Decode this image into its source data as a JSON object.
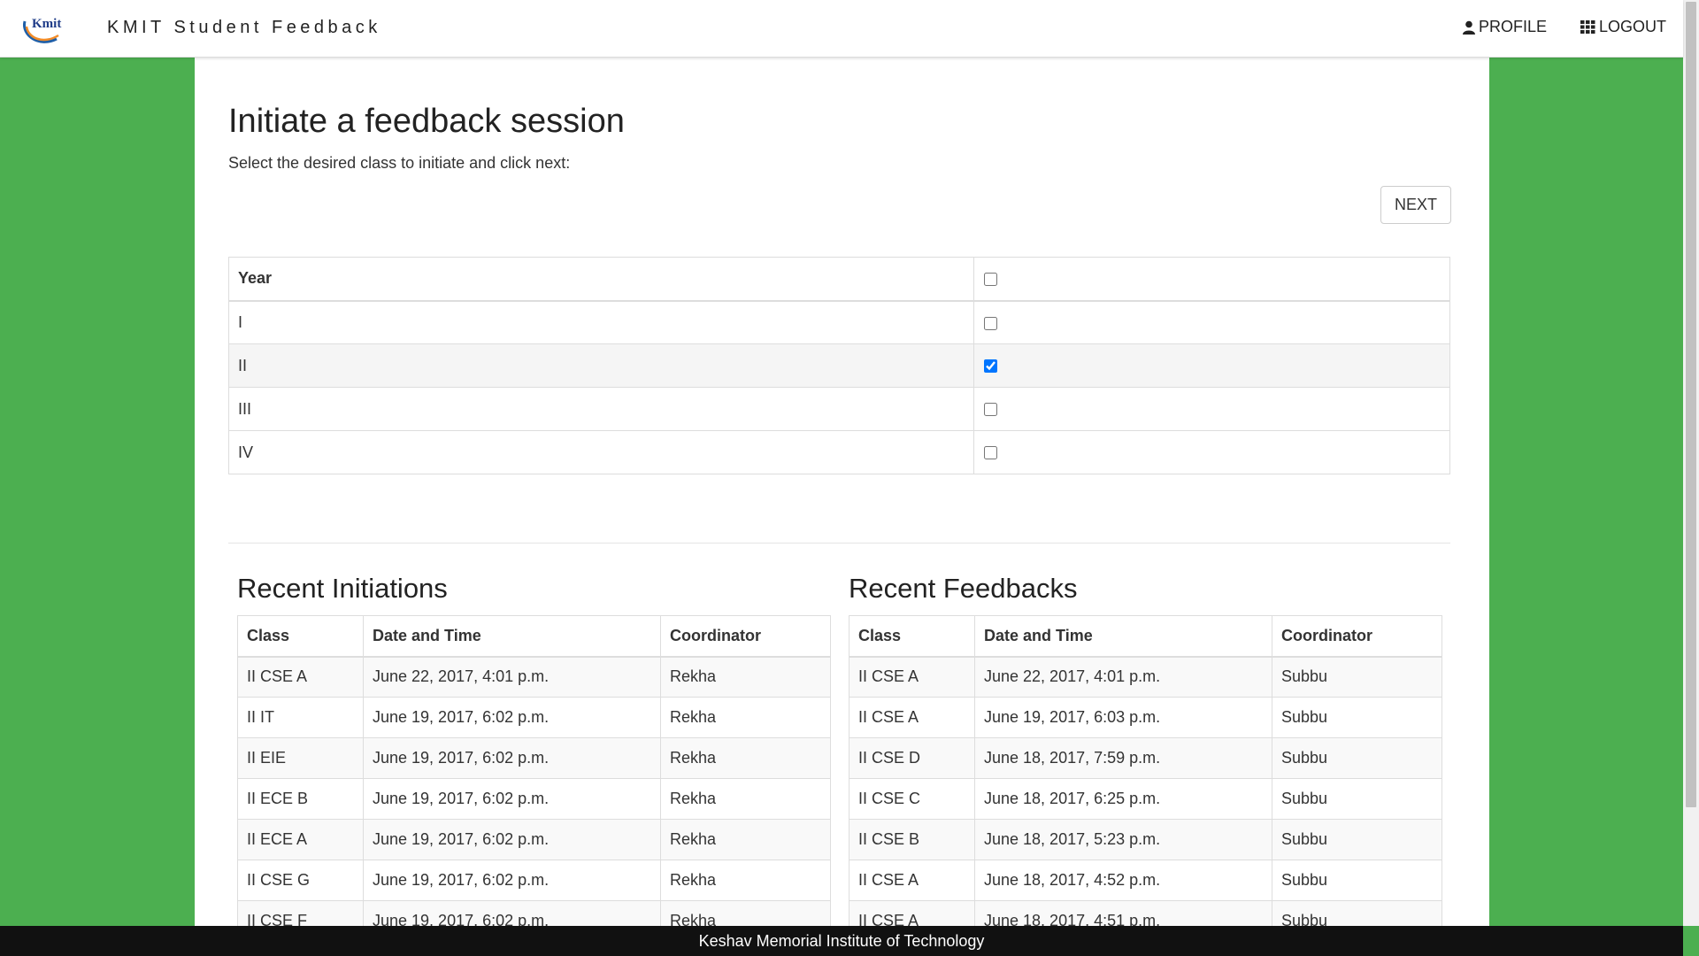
{
  "header": {
    "brand": "KMIT Student Feedback",
    "logo_text": "Kmit",
    "profile_label": "PROFILE",
    "logout_label": "LOGOUT"
  },
  "main": {
    "title": "Initiate a feedback session",
    "subtitle": "Select the desired class to initiate and click next:",
    "next_label": "NEXT",
    "year_table": {
      "header": "Year",
      "header_checked": false,
      "rows": [
        {
          "label": "I",
          "checked": false
        },
        {
          "label": "II",
          "checked": true
        },
        {
          "label": "III",
          "checked": false
        },
        {
          "label": "IV",
          "checked": false
        }
      ]
    }
  },
  "recent_initiations": {
    "title": "Recent Initiations",
    "columns": [
      "Class",
      "Date and Time",
      "Coordinator"
    ],
    "rows": [
      [
        "II CSE A",
        "June 22, 2017, 4:01 p.m.",
        "Rekha"
      ],
      [
        "II IT",
        "June 19, 2017, 6:02 p.m.",
        "Rekha"
      ],
      [
        "II EIE",
        "June 19, 2017, 6:02 p.m.",
        "Rekha"
      ],
      [
        "II ECE B",
        "June 19, 2017, 6:02 p.m.",
        "Rekha"
      ],
      [
        "II ECE A",
        "June 19, 2017, 6:02 p.m.",
        "Rekha"
      ],
      [
        "II CSE G",
        "June 19, 2017, 6:02 p.m.",
        "Rekha"
      ],
      [
        "II CSE F",
        "June 19, 2017, 6:02 p.m.",
        "Rekha"
      ]
    ]
  },
  "recent_feedbacks": {
    "title": "Recent Feedbacks",
    "columns": [
      "Class",
      "Date and Time",
      "Coordinator"
    ],
    "rows": [
      [
        "II CSE A",
        "June 22, 2017, 4:01 p.m.",
        "Subbu"
      ],
      [
        "II CSE A",
        "June 19, 2017, 6:03 p.m.",
        "Subbu"
      ],
      [
        "II CSE D",
        "June 18, 2017, 7:59 p.m.",
        "Subbu"
      ],
      [
        "II CSE C",
        "June 18, 2017, 6:25 p.m.",
        "Subbu"
      ],
      [
        "II CSE B",
        "June 18, 2017, 5:23 p.m.",
        "Subbu"
      ],
      [
        "II CSE A",
        "June 18, 2017, 4:52 p.m.",
        "Subbu"
      ],
      [
        "II CSE A",
        "June 18, 2017, 4:51 p.m.",
        "Subbu"
      ]
    ]
  },
  "footer": {
    "text": "Keshav Memorial Institute of Technology"
  },
  "colors": {
    "page_background": "#4caf50",
    "footer_background": "#111111",
    "logo_blue": "#1f5fa8",
    "logo_orange": "#f28c28"
  }
}
